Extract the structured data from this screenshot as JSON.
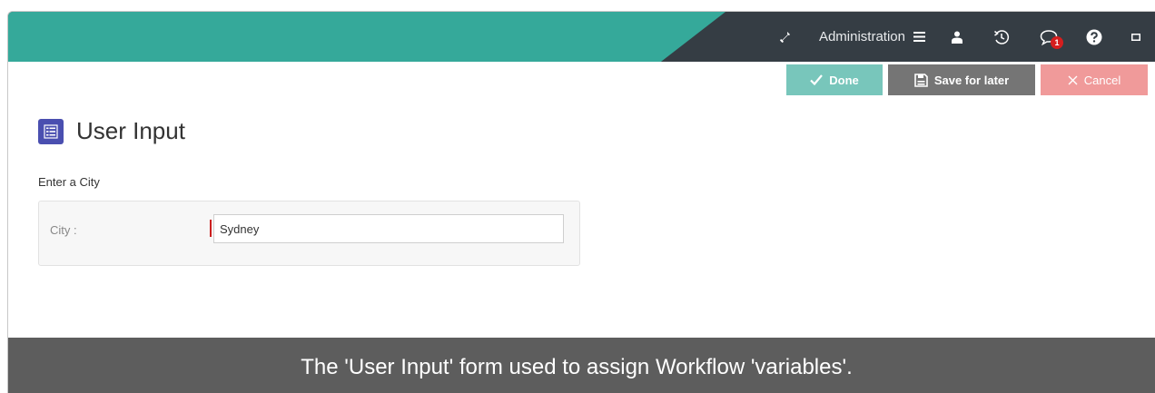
{
  "header": {
    "admin_label": "Administration",
    "notification_count": "1",
    "icons": [
      "wrench-icon",
      "hamburger-menu-icon",
      "user-icon",
      "history-icon",
      "comments-icon",
      "help-icon",
      "window-icon"
    ]
  },
  "actions": {
    "done_label": "Done",
    "save_label": "Save for later",
    "cancel_label": "Cancel"
  },
  "page": {
    "title": "User Input",
    "section_label": "Enter a City"
  },
  "form": {
    "city_label": "City :",
    "city_value": "Sydney"
  },
  "caption": {
    "text": "The 'User Input' form used to assign Workflow 'variables'."
  },
  "colors": {
    "topbar_dark": "#353d44",
    "topbar_teal": "#35a99a",
    "done": "#78c6bb",
    "save": "#757575",
    "cancel": "#f09a9a",
    "title_icon": "#4a4fb0",
    "required": "#cc1f1f",
    "badge": "#d51e1e"
  }
}
